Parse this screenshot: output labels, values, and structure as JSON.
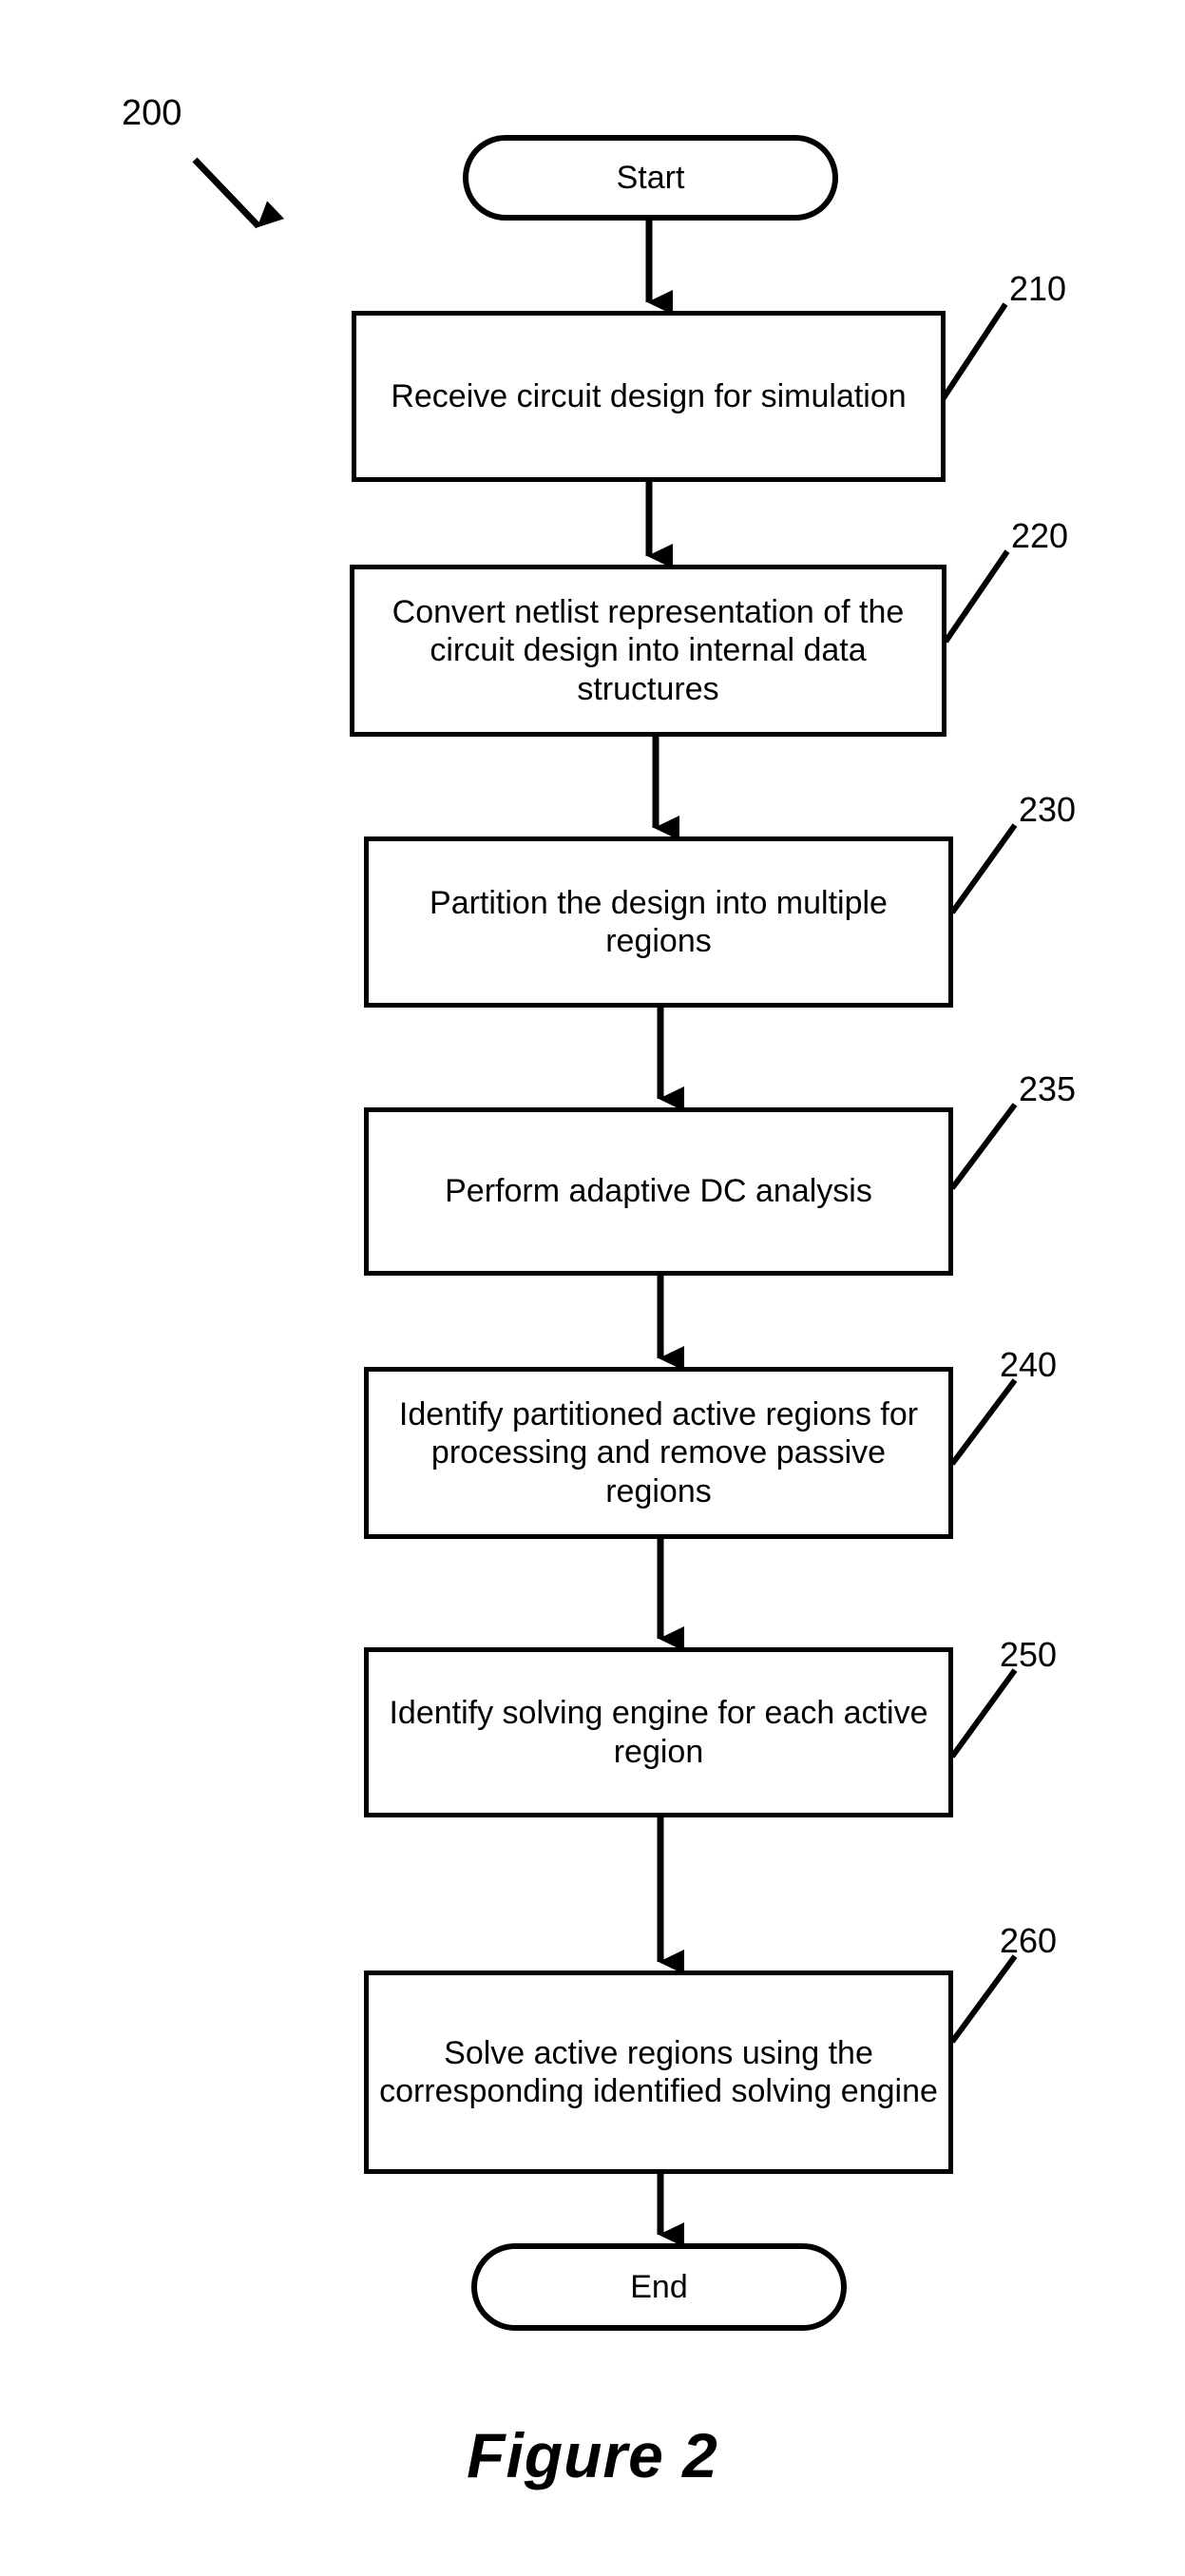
{
  "figure": {
    "caption": "Figure 2",
    "diagram_ref": "200"
  },
  "diagram": {
    "type": "flowchart",
    "orientation": "top-to-bottom",
    "nodes": [
      {
        "id": "start",
        "shape": "terminal",
        "label": "Start",
        "ref": ""
      },
      {
        "id": "s210",
        "shape": "process",
        "label": "Receive circuit design for simulation",
        "ref": "210"
      },
      {
        "id": "s220",
        "shape": "process",
        "label": "Convert netlist representation of the circuit design into internal data structures",
        "ref": "220"
      },
      {
        "id": "s230",
        "shape": "process",
        "label": "Partition the design into multiple regions",
        "ref": "230"
      },
      {
        "id": "s235",
        "shape": "process",
        "label": "Perform adaptive DC analysis",
        "ref": "235"
      },
      {
        "id": "s240",
        "shape": "process",
        "label": "Identify partitioned active regions for processing and remove passive regions",
        "ref": "240"
      },
      {
        "id": "s250",
        "shape": "process",
        "label": "Identify solving engine for each active region",
        "ref": "250"
      },
      {
        "id": "s260",
        "shape": "process",
        "label": "Solve active regions using the corresponding identified solving engine",
        "ref": "260"
      },
      {
        "id": "end",
        "shape": "terminal",
        "label": "End",
        "ref": ""
      }
    ],
    "edges": [
      {
        "from": "start",
        "to": "s210"
      },
      {
        "from": "s210",
        "to": "s220"
      },
      {
        "from": "s220",
        "to": "s230"
      },
      {
        "from": "s230",
        "to": "s235"
      },
      {
        "from": "s235",
        "to": "s240"
      },
      {
        "from": "s240",
        "to": "s250"
      },
      {
        "from": "s250",
        "to": "s260"
      },
      {
        "from": "s260",
        "to": "end"
      }
    ]
  },
  "colors": {
    "line": "#000000",
    "background": "#ffffff",
    "text": "#000000"
  }
}
